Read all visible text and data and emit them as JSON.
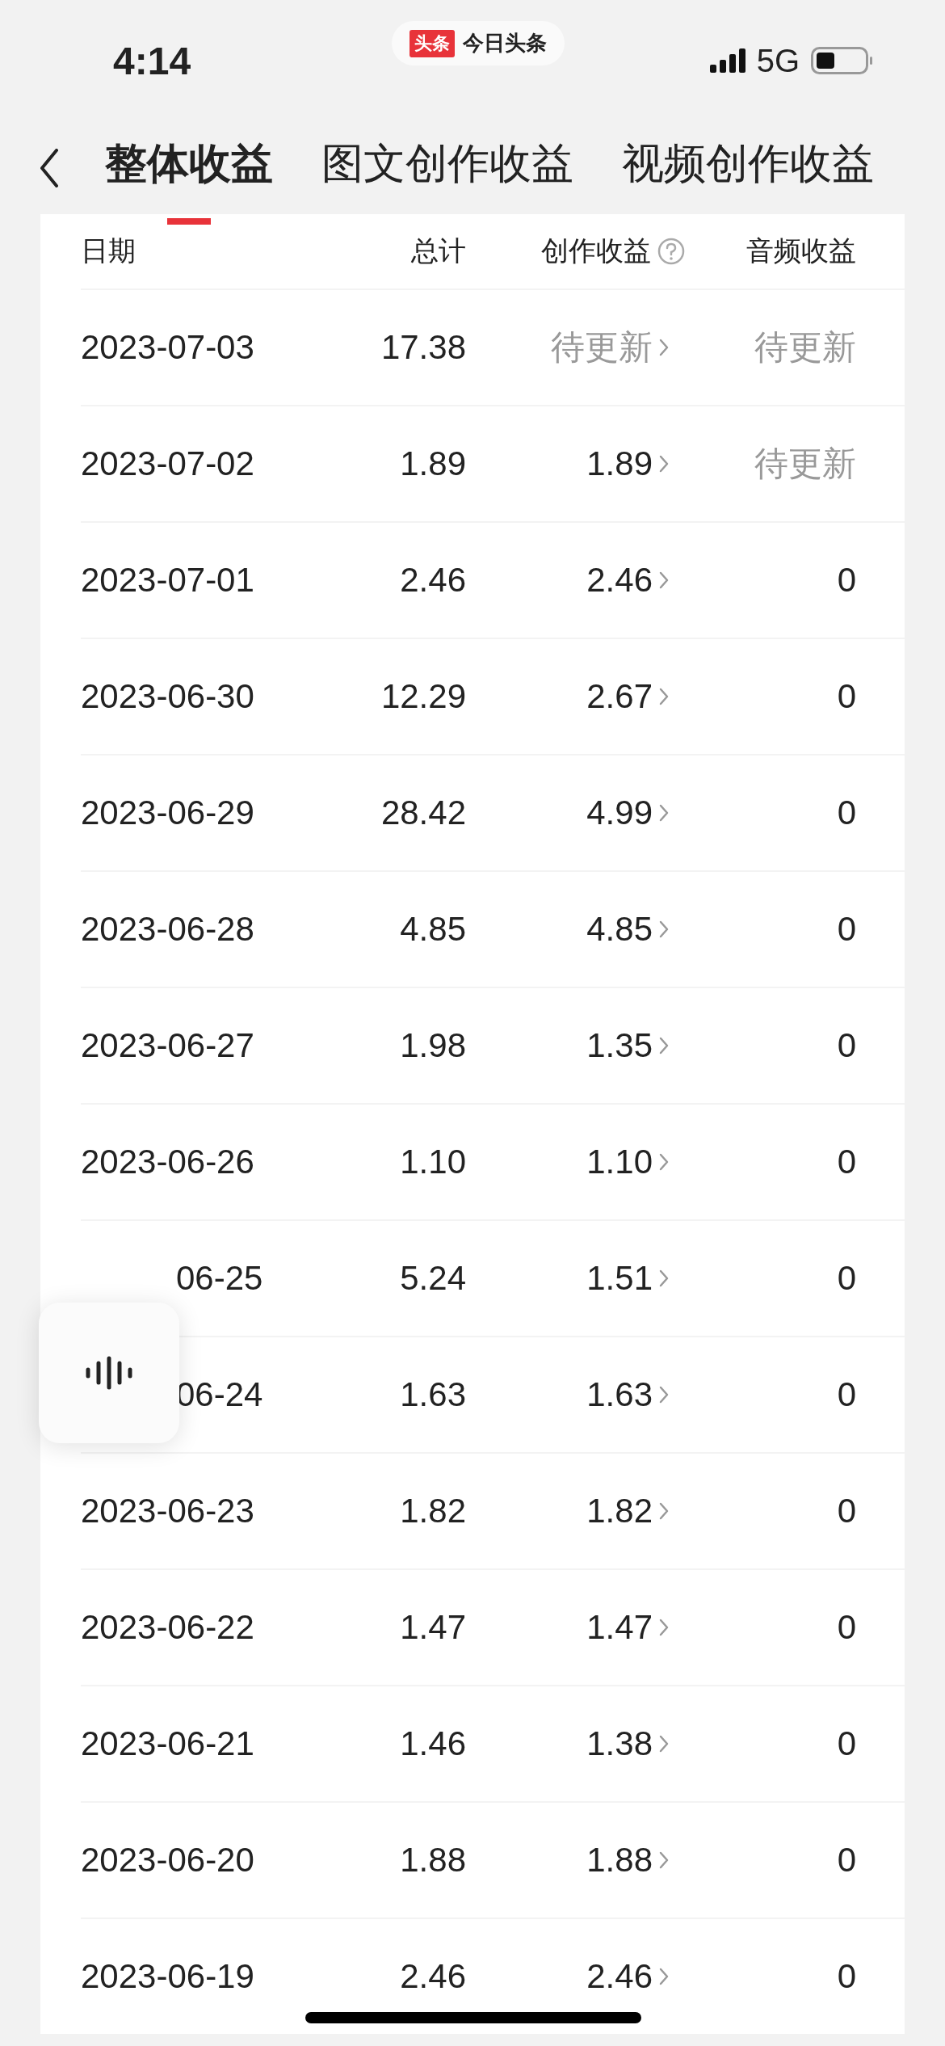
{
  "status_bar": {
    "time": "4:14",
    "app_pill": {
      "badge": "头条",
      "name": "今日头条"
    },
    "network": "5G"
  },
  "tabs": [
    {
      "label": "整体收益",
      "selected": true
    },
    {
      "label": "图文创作收益",
      "selected": false
    },
    {
      "label": "视频创作收益",
      "selected": false
    }
  ],
  "table": {
    "columns": [
      "日期",
      "总计",
      "创作收益",
      "音频收益"
    ],
    "rows": [
      {
        "date": "2023-07-03",
        "covered": false,
        "total": "17.38",
        "creation": {
          "text": "待更新",
          "pending": true
        },
        "audio": {
          "text": "待更新",
          "pending": true
        }
      },
      {
        "date": "2023-07-02",
        "covered": false,
        "total": "1.89",
        "creation": {
          "text": "1.89",
          "pending": false
        },
        "audio": {
          "text": "待更新",
          "pending": true
        }
      },
      {
        "date": "2023-07-01",
        "covered": false,
        "total": "2.46",
        "creation": {
          "text": "2.46",
          "pending": false
        },
        "audio": {
          "text": "0",
          "pending": false
        }
      },
      {
        "date": "2023-06-30",
        "covered": false,
        "total": "12.29",
        "creation": {
          "text": "2.67",
          "pending": false
        },
        "audio": {
          "text": "0",
          "pending": false
        }
      },
      {
        "date": "2023-06-29",
        "covered": false,
        "total": "28.42",
        "creation": {
          "text": "4.99",
          "pending": false
        },
        "audio": {
          "text": "0",
          "pending": false
        }
      },
      {
        "date": "2023-06-28",
        "covered": false,
        "total": "4.85",
        "creation": {
          "text": "4.85",
          "pending": false
        },
        "audio": {
          "text": "0",
          "pending": false
        }
      },
      {
        "date": "2023-06-27",
        "covered": false,
        "total": "1.98",
        "creation": {
          "text": "1.35",
          "pending": false
        },
        "audio": {
          "text": "0",
          "pending": false
        }
      },
      {
        "date": "2023-06-26",
        "covered": false,
        "total": "1.10",
        "creation": {
          "text": "1.10",
          "pending": false
        },
        "audio": {
          "text": "0",
          "pending": false
        }
      },
      {
        "date": "06-25",
        "covered": true,
        "total": "5.24",
        "creation": {
          "text": "1.51",
          "pending": false
        },
        "audio": {
          "text": "0",
          "pending": false
        }
      },
      {
        "date": "06-24",
        "covered": true,
        "total": "1.63",
        "creation": {
          "text": "1.63",
          "pending": false
        },
        "audio": {
          "text": "0",
          "pending": false
        }
      },
      {
        "date": "2023-06-23",
        "covered": false,
        "total": "1.82",
        "creation": {
          "text": "1.82",
          "pending": false
        },
        "audio": {
          "text": "0",
          "pending": false
        }
      },
      {
        "date": "2023-06-22",
        "covered": false,
        "total": "1.47",
        "creation": {
          "text": "1.47",
          "pending": false
        },
        "audio": {
          "text": "0",
          "pending": false
        }
      },
      {
        "date": "2023-06-21",
        "covered": false,
        "total": "1.46",
        "creation": {
          "text": "1.38",
          "pending": false
        },
        "audio": {
          "text": "0",
          "pending": false
        }
      },
      {
        "date": "2023-06-20",
        "covered": false,
        "total": "1.88",
        "creation": {
          "text": "1.88",
          "pending": false
        },
        "audio": {
          "text": "0",
          "pending": false
        }
      },
      {
        "date": "2023-06-19",
        "covered": false,
        "total": "2.46",
        "creation": {
          "text": "2.46",
          "pending": false
        },
        "audio": {
          "text": "0",
          "pending": false
        }
      }
    ]
  }
}
